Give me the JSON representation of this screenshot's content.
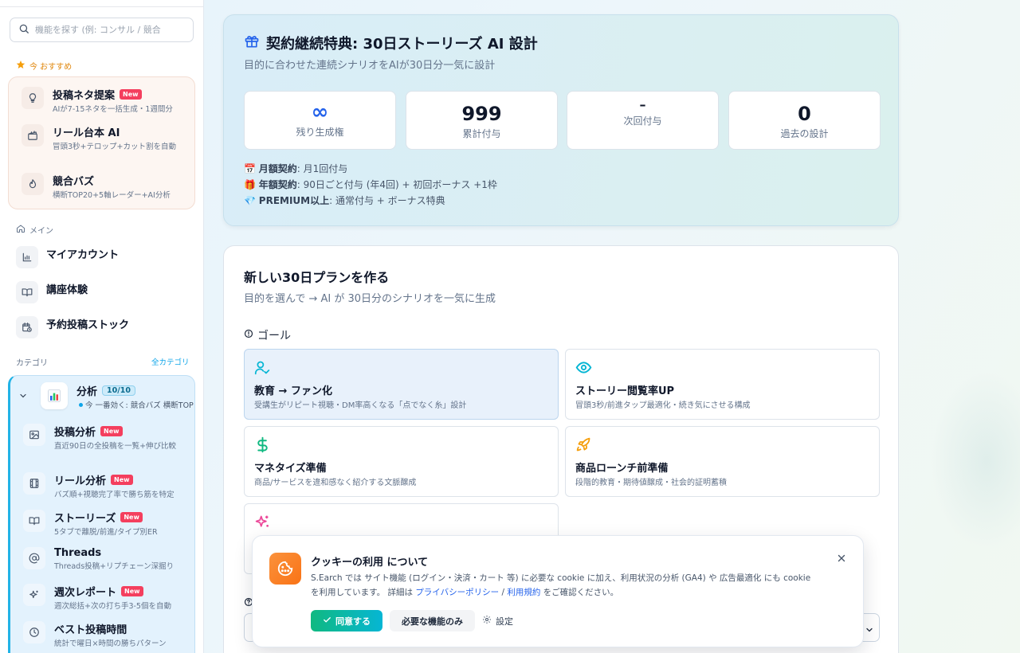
{
  "sidebar": {
    "search": {
      "placeholder": "機能を探す (例: コンサル / 競合"
    },
    "recommend": {
      "label": "今 おすすめ",
      "items": [
        {
          "title": "投稿ネタ提案",
          "badge": "New",
          "sub": "AIが7-15ネタを一括生成・1週間分"
        },
        {
          "title": "リール台本 AI",
          "sub": "冒頭3秒+テロップ+カット割を自動"
        },
        {
          "title": "競合バズ",
          "sub": "横断TOP20+5軸レーダー+AI分析"
        }
      ]
    },
    "main": {
      "label": "メイン",
      "items": [
        {
          "title": "マイアカウント"
        },
        {
          "title": "講座体験"
        },
        {
          "title": "予約投稿ストック"
        }
      ]
    },
    "category": {
      "label": "カテゴリ",
      "all_link": "全カテゴリ",
      "group": {
        "title": "分析",
        "count": "10/10",
        "sub": "今 一番効く: 競合バズ 横断TOP"
      },
      "items": [
        {
          "title": "投稿分析",
          "badge": "New",
          "sub": "直近90日の全投稿を一覧+伸び比較"
        },
        {
          "title": "リール分析",
          "badge": "New",
          "sub": "バズ順+視聴完了率で勝ち筋を特定"
        },
        {
          "title": "ストーリーズ",
          "badge": "New",
          "sub": "5タブで離脱/前進/タイプ別ER"
        },
        {
          "title": "Threads",
          "sub": "Threads投稿+リプチェーン深掘り"
        },
        {
          "title": "週次レポート",
          "badge": "New",
          "sub": "週次総括+次の打ち手3-5個を自動"
        },
        {
          "title": "ベスト投稿時間",
          "sub": "統計で曜日×時間の勝ちパターン"
        }
      ]
    }
  },
  "bonus": {
    "title": "契約継続特典: 30日ストーリーズ AI 設計",
    "subtitle": "目的に合わせた連続シナリオをAIが30日分一気に設計",
    "stats": [
      {
        "value": "∞",
        "label": "残り生成権"
      },
      {
        "value": "999",
        "label": "累計付与"
      },
      {
        "value": "–",
        "label": "次回付与"
      },
      {
        "value": "0",
        "label": "過去の設計"
      }
    ],
    "contracts": [
      {
        "emoji": "📅",
        "name": "月額契約",
        "text": ": 月1回付与"
      },
      {
        "emoji": "🎁",
        "name": "年額契約",
        "text": ": 90日ごと付与 (年4回) + 初回ボーナス +1枠"
      },
      {
        "emoji": "💎",
        "name": "PREMIUM以上",
        "text": ": 通常付与 + ボーナス特典"
      }
    ]
  },
  "plan": {
    "title": "新しい30日プランを作る",
    "subtitle": "目的を選んで → AI が 30日分のシナリオを一気に生成",
    "goal_label": "ゴール",
    "goals": [
      {
        "title": "教育 → ファン化",
        "desc": "受講生がリピート視聴・DM率高くなる「点でなく糸」設計",
        "icon": "user-check-icon"
      },
      {
        "title": "ストーリー閲覧率UP",
        "desc": "冒頭3秒/前進タップ最適化・続き気にさせる構成",
        "icon": "eye-icon"
      },
      {
        "title": "マネタイズ準備",
        "desc": "商品/サービスを違和感なく紹介する文脈醸成",
        "icon": "dollar-icon"
      },
      {
        "title": "商品ローンチ前準備",
        "desc": "段階的教育・期待値醸成・社会的証明蓄積",
        "icon": "rocket-icon"
      }
    ]
  },
  "cookie": {
    "title": "クッキーの利用 について",
    "body_part1": "S.Earch では サイト機能 (ログイン・決済・カート 等) に必要な cookie に加え、利用状況の分析 (GA4) や 広告最適化 にも cookie を利用しています。 詳細は ",
    "privacy_link": "プライバシーポリシー",
    "separator": " / ",
    "terms_link": "利用規約",
    "body_part2": " をご確認ください。",
    "agree_button": "同意する",
    "necessary_button": "必要な機能のみ",
    "settings_button": "設定"
  },
  "colors": {
    "accent_blue": "#2563eb",
    "new_badge": "#f43f5e",
    "recommend_orange": "#e0860b",
    "agree_gradient_start": "#10b981",
    "agree_gradient_end": "#06b6d4",
    "cookie_orange": "#f97316"
  }
}
